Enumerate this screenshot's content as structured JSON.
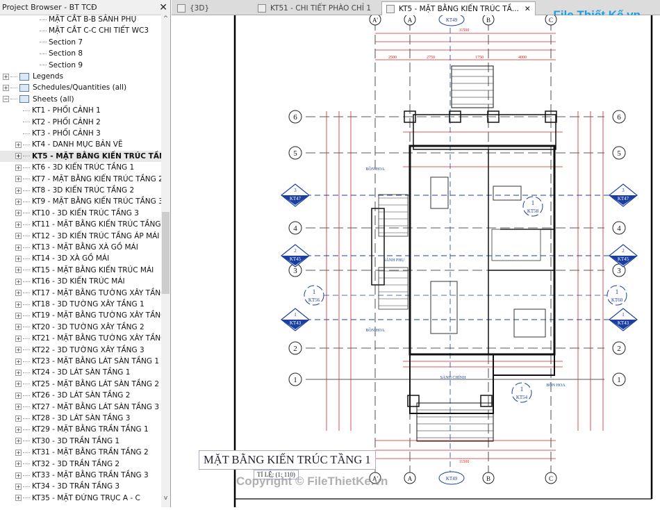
{
  "browser": {
    "title": "Project Browser - BT TCĐ",
    "close": "✕",
    "scroll_up": "^",
    "scroll_down": "v",
    "items": [
      {
        "label": "MẶT CẮT B-B SẢNH PHỤ",
        "level": 3
      },
      {
        "label": "MẶT CẮT C-C CHI TIẾT WC3",
        "level": 3
      },
      {
        "label": "Section 7",
        "level": 3
      },
      {
        "label": "Section 8",
        "level": 3
      },
      {
        "label": "Section 9",
        "level": 3
      },
      {
        "label": "Legends",
        "level": 0,
        "expander": "+",
        "icon": "legend-icon"
      },
      {
        "label": "Schedules/Quantities (all)",
        "level": 0,
        "expander": "+",
        "icon": "schedule-icon"
      },
      {
        "label": "Sheets (all)",
        "level": 0,
        "expander": "−",
        "icon": "sheet-icon"
      },
      {
        "label": "KT1 - PHỐI CẢNH 1",
        "level": 1
      },
      {
        "label": "KT2 - PHỐI CẢNH 2",
        "level": 1
      },
      {
        "label": "KT3 - PHỐI CẢNH 3",
        "level": 1
      },
      {
        "label": "KT4 - DANH MỤC BẢN VẼ",
        "level": 1,
        "expander": "+"
      },
      {
        "label": "KT5 - MẶT BẰNG KIẾN TRÚC TẦNG 1",
        "level": 1,
        "expander": "+",
        "selected": true
      },
      {
        "label": "KT6 - 3D KIẾN TRÚC TẦNG 1",
        "level": 1,
        "expander": "+"
      },
      {
        "label": "KT7 - MẶT BẰNG KIẾN TRÚC TẦNG 2",
        "level": 1,
        "expander": "+"
      },
      {
        "label": "KT8 - 3D KIẾN TRÚC TẦNG 2",
        "level": 1,
        "expander": "+"
      },
      {
        "label": "KT9 - MẶT BẰNG KIẾN TRÚC TẦNG 3",
        "level": 1,
        "expander": "+"
      },
      {
        "label": "KT10 - 3D KIẾN TRÚC TẦNG 3",
        "level": 1,
        "expander": "+"
      },
      {
        "label": "KT11 - MẶT BẰNG KIẾN TRÚC TẦNG ÁP MÁI",
        "level": 1,
        "expander": "+"
      },
      {
        "label": "KT12 - 3D KIẾN TRÚC TẦNG ÁP MÁI",
        "level": 1,
        "expander": "+"
      },
      {
        "label": "KT13 - MẶT BẰNG XÀ GỒ MÁI",
        "level": 1,
        "expander": "+"
      },
      {
        "label": "KT14 - 3D XÀ GỒ MÁI",
        "level": 1,
        "expander": "+"
      },
      {
        "label": "KT15 - MẶT BẰNG KIẾN TRÚC MÁI",
        "level": 1,
        "expander": "+"
      },
      {
        "label": "KT16 - 3D KIẾN TRÚC MÁI",
        "level": 1,
        "expander": "+"
      },
      {
        "label": "KT17 - MẶT BẰNG TƯỜNG XÂY TẦNG 1",
        "level": 1,
        "expander": "+"
      },
      {
        "label": "KT18 - 3D TƯỜNG XÂY TẦNG 1",
        "level": 1,
        "expander": "+"
      },
      {
        "label": "KT19 - MẶT BẰNG TƯỜNG XÂY TẦNG 2",
        "level": 1,
        "expander": "+"
      },
      {
        "label": "KT20 - 3D TƯỜNG XÂY TẦNG 2",
        "level": 1,
        "expander": "+"
      },
      {
        "label": "KT21 - MẶT BẰNG TƯỜNG XÂY TẦNG 3",
        "level": 1,
        "expander": "+"
      },
      {
        "label": "KT22 - 3D TƯỜNG XÂY TẦNG 3",
        "level": 1,
        "expander": "+"
      },
      {
        "label": "KT23 - MẶT BẰNG LÁT SÀN TẦNG 1",
        "level": 1,
        "expander": "+"
      },
      {
        "label": "KT24 - 3D LÁT SÀN TẦNG 1",
        "level": 1,
        "expander": "+"
      },
      {
        "label": "KT25 - MẶT BẰNG LÁT SÀN TẦNG 2",
        "level": 1,
        "expander": "+"
      },
      {
        "label": "KT26 - 3D LÁT SÀN TẦNG 2",
        "level": 1,
        "expander": "+"
      },
      {
        "label": "KT27 - MẶT BẰNG LÁT SÀN TẦNG 3",
        "level": 1,
        "expander": "+"
      },
      {
        "label": "KT28 - 3D LÁT SÀN TẦNG 3",
        "level": 1,
        "expander": "+"
      },
      {
        "label": "KT29 - MẶT BẰNG TRẦN TẦNG 1",
        "level": 1,
        "expander": "+"
      },
      {
        "label": "KT30 - 3D TRẦN TẦNG 1",
        "level": 1,
        "expander": "+"
      },
      {
        "label": "KT31 - MẶT BẰNG TRẦN TẦNG 2",
        "level": 1,
        "expander": "+"
      },
      {
        "label": "KT32 - 3D TRẦN TẦNG 2",
        "level": 1,
        "expander": "+"
      },
      {
        "label": "KT33 - MẶT BẰNG TRẦN TẦNG 3",
        "level": 1,
        "expander": "+"
      },
      {
        "label": "KT34 - 3D TRẦN TẦNG 3",
        "level": 1,
        "expander": "+"
      },
      {
        "label": "KT35 - MẶT ĐỨNG TRỤC A - C",
        "level": 1,
        "expander": "+"
      }
    ]
  },
  "tabs": [
    {
      "label": "{3D}",
      "icon": "3d-view-icon"
    },
    {
      "label": "KT51 - CHI TIẾT PHÀO CHỈ 1",
      "icon": "sheet-icon"
    },
    {
      "label": "KT5 - MẶT BẰNG KIẾN TRÚC TẦ...",
      "icon": "sheet-icon",
      "active": true,
      "close": "✕"
    }
  ],
  "logo": "File Thiết Kế.vn",
  "drawing": {
    "title": "MẶT BẰNG KIẾN TRÚC TẦNG 1",
    "scale": "TỈ LỆ: (1: 110)",
    "watermark": "Copyright © FileThietKe.vn",
    "grid_rows": [
      "6",
      "5",
      "4",
      "3",
      "2",
      "1"
    ],
    "grid_cols": [
      "A'",
      "A",
      "B",
      "C"
    ],
    "sections": [
      {
        "num": "3",
        "sheet": "KT47"
      },
      {
        "num": "2",
        "sheet": "KT45"
      },
      {
        "num": "1",
        "sheet": "KT43"
      }
    ],
    "elevations": [
      {
        "num": "1",
        "sheet": "KT56"
      },
      {
        "num": "1",
        "sheet": "KT60"
      },
      {
        "num": "1",
        "sheet": "KT58"
      },
      {
        "num": "1",
        "sheet": "KT54"
      }
    ],
    "top_marker": "KT49",
    "bottom_marker": "KT49",
    "rooms": [
      "BỒN HOA",
      "BỒN HOA",
      "SẢNH PHỤ",
      "SẢNH CHÍNH",
      "BỒN HOA"
    ],
    "overall_dim": "11500",
    "top_dims": [
      "2500",
      "2750",
      "1750",
      "4000"
    ],
    "colors": {
      "dimension": "#d42020",
      "grid": "#222222",
      "section": "#1a3fa0",
      "wall": "#111111"
    }
  }
}
